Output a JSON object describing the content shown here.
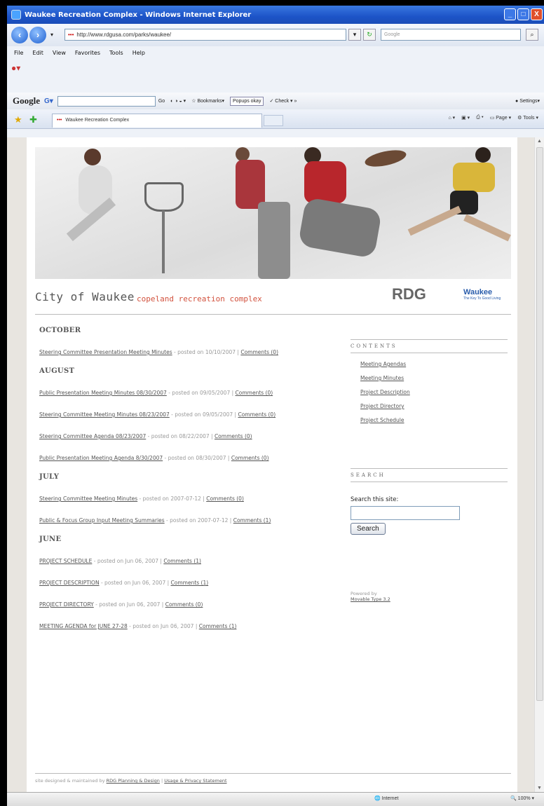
{
  "window": {
    "title": "Waukee Recreation Complex - Windows Internet Explorer",
    "min": "_",
    "max": "□",
    "close": "X"
  },
  "address": {
    "url": "http://www.rdgusa.com/parks/waukee/",
    "search_placeholder": "Google"
  },
  "menu": [
    "File",
    "Edit",
    "View",
    "Favorites",
    "Tools",
    "Help"
  ],
  "google_bar": {
    "logo": "Google",
    "go": "Go",
    "bookmarks": "Bookmarks",
    "popups": "Popups okay",
    "check": "Check",
    "settings": "Settings"
  },
  "tab": {
    "title": "Waukee Recreation Complex"
  },
  "command_bar": {
    "page": "Page",
    "tools": "Tools"
  },
  "brand": {
    "city": "City of Waukee",
    "subtitle": "copeland recreation complex",
    "rdg": "RDG",
    "waukee": "Waukee",
    "tagline": "The Key To Good Living"
  },
  "archive": [
    {
      "month": "OCTOBER",
      "entries": [
        {
          "title": "Steering Committee Presentation Meeting Minutes",
          "posted": " - posted on 10/10/2007 | ",
          "comments": "Comments (0)"
        }
      ]
    },
    {
      "month": "AUGUST",
      "entries": [
        {
          "title": "Public Presentation Meeting Minutes 08/30/2007",
          "posted": " - posted on 09/05/2007 | ",
          "comments": "Comments (0)"
        },
        {
          "title": "Steering Committee Meeting Minutes 08/23/2007",
          "posted": " - posted on 09/05/2007 | ",
          "comments": "Comments (0)"
        },
        {
          "title": "Steering Committee Agenda 08/23/2007",
          "posted": " - posted on 08/22/2007 | ",
          "comments": "Comments (0)"
        },
        {
          "title": "Public Presentation Meeting Agenda 8/30/2007",
          "posted": " - posted on 08/30/2007 | ",
          "comments": "Comments (0)"
        }
      ]
    },
    {
      "month": "JULY",
      "entries": [
        {
          "title": "Steering Committee Meeting Minutes",
          "posted": " - posted on 2007-07-12 | ",
          "comments": "Comments (0)"
        },
        {
          "title": "Public & Focus Group Input Meeting Summaries",
          "posted": " - posted on 2007-07-12 | ",
          "comments": "Comments (1)"
        }
      ]
    },
    {
      "month": "JUNE",
      "entries": [
        {
          "title": "PROJECT SCHEDULE",
          "posted": " - posted on Jun 06, 2007 | ",
          "comments": "Comments (1)"
        },
        {
          "title": "PROJECT DESCRIPTION",
          "posted": " - posted on Jun 06, 2007 | ",
          "comments": "Comments (1)"
        },
        {
          "title": "PROJECT DIRECTORY",
          "posted": " - posted on Jun 06, 2007 | ",
          "comments": "Comments (0)"
        },
        {
          "title": "MEETING AGENDA for JUNE 27-28",
          "posted": " - posted on Jun 06, 2007 | ",
          "comments": "Comments (1)"
        }
      ]
    }
  ],
  "sidebar": {
    "contents_header": "CONTENTS",
    "links": [
      "Meeting Agendas",
      "Meeting Minutes",
      "Project Description",
      "Project Directory",
      "Project Schedule"
    ],
    "search_header": "SEARCH",
    "search_label": "Search this site:",
    "search_button": "Search",
    "powered_by": "Powered by",
    "powered_link": "Movable Type 3.2"
  },
  "footer": {
    "prefix": "site designed & maintained by ",
    "designer": "RDG Planning & Design",
    "sep": " | ",
    "privacy": "Usage & Privacy Statement"
  },
  "status": {
    "zone": "Internet",
    "zoom": "100%"
  }
}
